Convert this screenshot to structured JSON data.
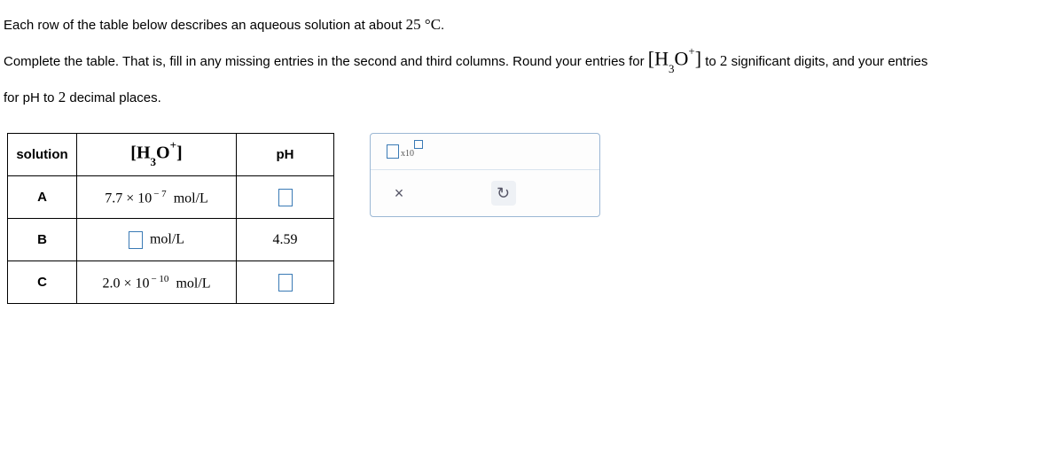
{
  "instructions": {
    "line1_pre": "Each row of the table below describes an aqueous solution at about ",
    "line1_temp": "25 °C",
    "line1_post": ".",
    "line2_pre": "Complete the table. That is, fill in any missing entries in the second and third columns. Round your entries for ",
    "h3o_expr": "H₃O⁺",
    "line2_mid": " to ",
    "sigdigits": "2",
    "line2_post1": " significant digits, and your entries",
    "line3_pre": "for pH to ",
    "decplaces": "2",
    "line3_post": " decimal places."
  },
  "table": {
    "headers": {
      "solution": "solution",
      "ph": "pH"
    },
    "header_conc": {
      "base": "H",
      "sub": "3",
      "o": "O",
      "sup": "+"
    },
    "rows": {
      "A": {
        "label": "A",
        "conc_pre": "7.7 × 10",
        "conc_exp": "− 7",
        "conc_unit": "mol/L",
        "ph": ""
      },
      "B": {
        "label": "B",
        "conc_pre": "",
        "conc_unit": "mol/L",
        "ph": "4.59"
      },
      "C": {
        "label": "C",
        "conc_pre": "2.0 × 10",
        "conc_exp": "− 10",
        "conc_unit": "mol/L",
        "ph": ""
      }
    }
  },
  "toolbox": {
    "sci_label_x10": "x10",
    "close": "×",
    "reset": "↺"
  }
}
